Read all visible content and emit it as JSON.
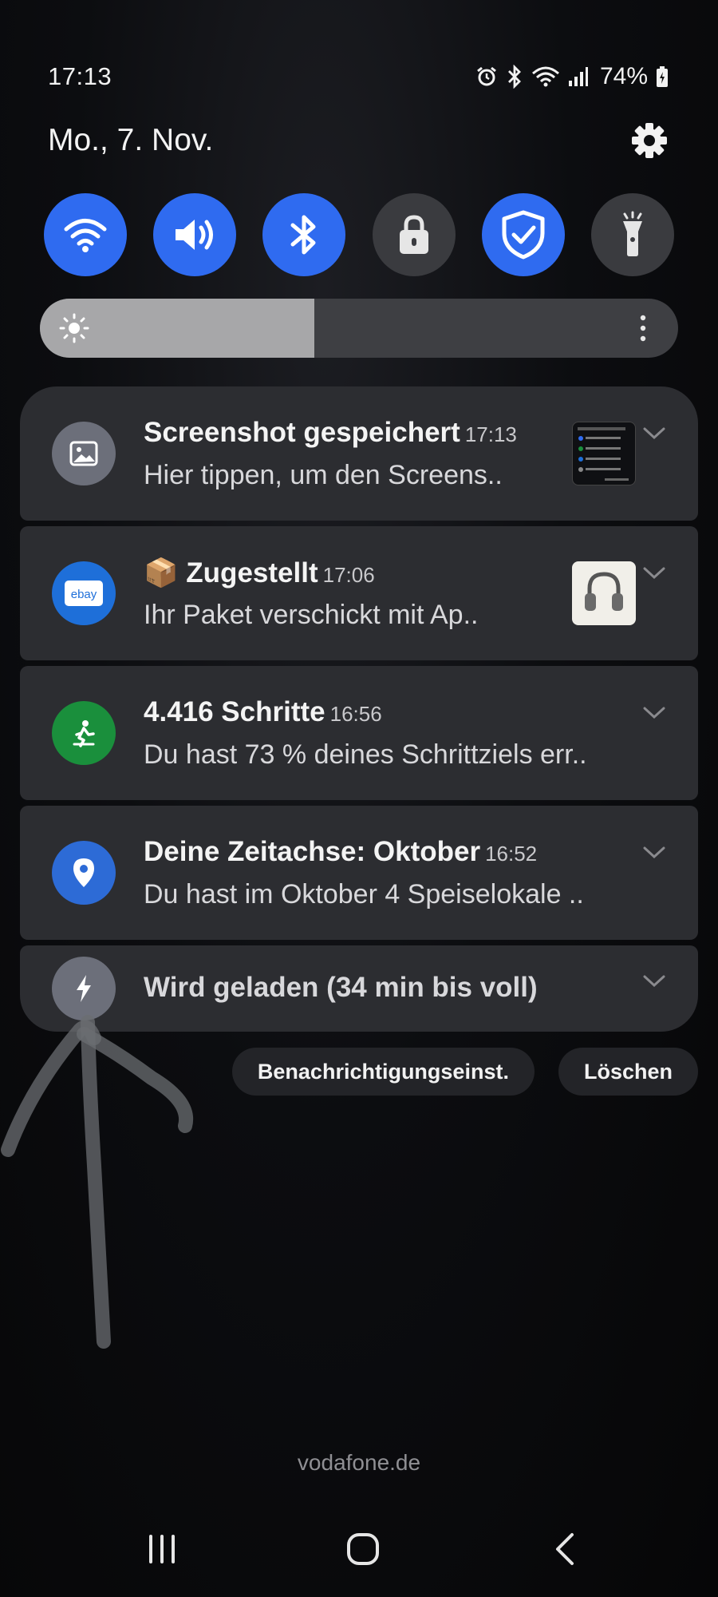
{
  "status_bar": {
    "time": "17:13",
    "battery": "74%",
    "icons": [
      "alarm-icon",
      "bluetooth-icon",
      "wifi-icon",
      "signal-icon",
      "battery-charging-icon"
    ]
  },
  "header": {
    "date": "Mo., 7. Nov."
  },
  "quick_settings": [
    {
      "name": "wifi",
      "icon": "wifi-icon",
      "active": true
    },
    {
      "name": "sound",
      "icon": "volume-icon",
      "active": true
    },
    {
      "name": "bluetooth",
      "icon": "bluetooth-icon",
      "active": true
    },
    {
      "name": "lock",
      "icon": "lock-icon",
      "active": false
    },
    {
      "name": "shield",
      "icon": "shield-check-icon",
      "active": true
    },
    {
      "name": "flashlight",
      "icon": "flashlight-icon",
      "active": false
    }
  ],
  "brightness": {
    "level": 0.43
  },
  "notifications": [
    {
      "title": "Screenshot gespeichert",
      "time": "17:13",
      "text": "Hier tippen, um den Screens..",
      "icon": "image-icon"
    },
    {
      "title": "📦 Zugestellt",
      "time": "17:06",
      "text": "Ihr Paket verschickt mit Ap..",
      "icon": "ebay-icon",
      "icon_text": "ebay"
    },
    {
      "title": "4.416 Schritte",
      "time": "16:56",
      "text": "Du hast 73 % deines Schrittziels err..",
      "icon": "walk-icon"
    },
    {
      "title": "Deine Zeitachse: Oktober",
      "time": "16:52",
      "text": "Du hast im Oktober 4 Speiselokale ..",
      "icon": "location-pin-icon"
    },
    {
      "title": "Wird geladen (34 min bis voll)",
      "icon": "charging-bolt-icon"
    }
  ],
  "actions": {
    "settings_label": "Benachrichtigungseinst.",
    "clear_label": "Löschen"
  },
  "carrier": "vodafone.de",
  "colors": {
    "accent": "#2f6bf0",
    "ebay_blue": "#1e6fd9",
    "health_green": "#1a8f3c",
    "maps_blue": "#2d6bd6",
    "gray_icon": "#6c6f7a"
  }
}
